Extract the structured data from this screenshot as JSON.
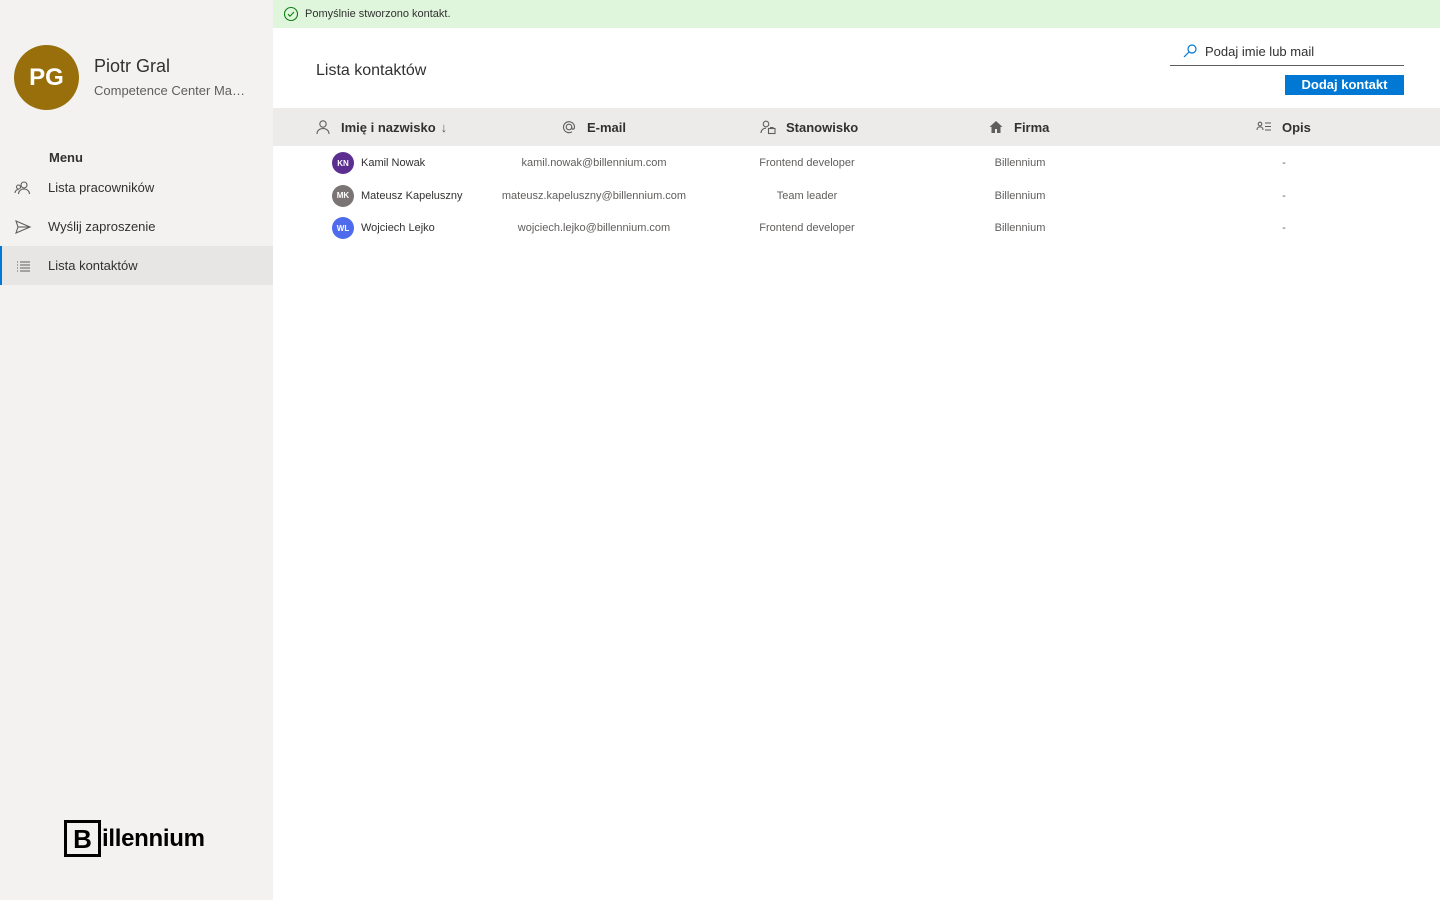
{
  "user": {
    "initials": "PG",
    "name": "Piotr Gral",
    "role": "Competence Center Manager",
    "avatar_color": "#986f0b"
  },
  "menu": {
    "title": "Menu",
    "items": [
      {
        "label": "Lista pracowników",
        "icon": "people-icon",
        "active": false
      },
      {
        "label": "Wyślij zaproszenie",
        "icon": "send-icon",
        "active": false
      },
      {
        "label": "Lista kontaktów",
        "icon": "list-icon",
        "active": true
      }
    ]
  },
  "brand": {
    "logo_letter": "B",
    "logo_text": "illennium"
  },
  "notification": {
    "text": "Pomyślnie stworzono kontakt.",
    "icon": "check-circle-icon",
    "color": "#dff6dd"
  },
  "page": {
    "title": "Lista kontaktów"
  },
  "search": {
    "placeholder": "Podaj imie lub mail",
    "value": ""
  },
  "actions": {
    "add_label": "Dodaj kontakt",
    "accent": "#0078d4"
  },
  "table": {
    "columns": [
      {
        "label": "Imię i nazwisko",
        "icon": "person-icon",
        "sort": "↓"
      },
      {
        "label": "E-mail",
        "icon": "at-icon"
      },
      {
        "label": "Stanowisko",
        "icon": "contact-card-icon"
      },
      {
        "label": "Firma",
        "icon": "home-icon"
      },
      {
        "label": "Opis",
        "icon": "text-list-icon"
      }
    ],
    "rows": [
      {
        "initials": "KN",
        "avatar_color": "#5c2e91",
        "name": "Kamil Nowak",
        "email": "kamil.nowak@billennium.com",
        "position": "Frontend developer",
        "company": "Billennium",
        "description": "-"
      },
      {
        "initials": "MK",
        "avatar_color": "#7a7574",
        "name": "Mateusz Kapeluszny",
        "email": "mateusz.kapeluszny@billennium.com",
        "position": "Team leader",
        "company": "Billennium",
        "description": "-"
      },
      {
        "initials": "WL",
        "avatar_color": "#4f6bed",
        "name": "Wojciech Lejko",
        "email": "wojciech.lejko@billennium.com",
        "position": "Frontend developer",
        "company": "Billennium",
        "description": "-"
      }
    ]
  }
}
